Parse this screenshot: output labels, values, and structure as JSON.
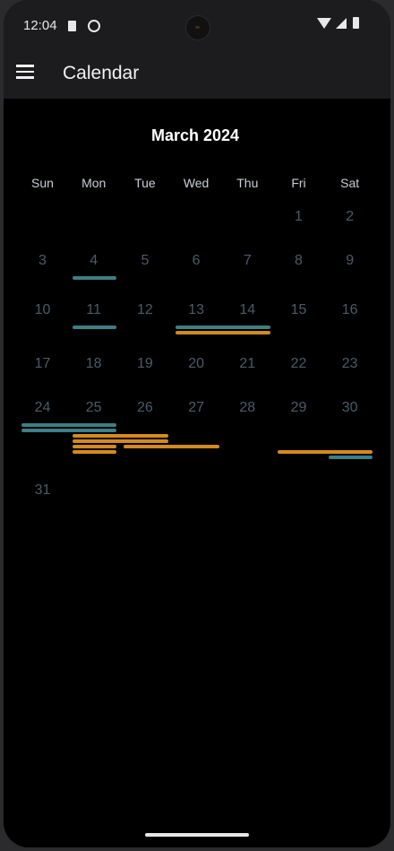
{
  "status_bar": {
    "time": "12:04",
    "icons": [
      "sd-card-icon",
      "face-icon",
      "wifi-icon",
      "cell-signal-icon",
      "battery-icon"
    ]
  },
  "app_bar": {
    "title": "Calendar",
    "menu_icon": "hamburger-menu-icon"
  },
  "calendar": {
    "month_label": "March 2024",
    "weekdays": [
      "Sun",
      "Mon",
      "Tue",
      "Wed",
      "Thu",
      "Fri",
      "Sat"
    ],
    "days": [
      {
        "label": "1",
        "week": 0,
        "dow": 5
      },
      {
        "label": "2",
        "week": 0,
        "dow": 6
      },
      {
        "label": "3",
        "week": 1,
        "dow": 0
      },
      {
        "label": "4",
        "week": 1,
        "dow": 1
      },
      {
        "label": "5",
        "week": 1,
        "dow": 2
      },
      {
        "label": "6",
        "week": 1,
        "dow": 3
      },
      {
        "label": "7",
        "week": 1,
        "dow": 4
      },
      {
        "label": "8",
        "week": 1,
        "dow": 5
      },
      {
        "label": "9",
        "week": 1,
        "dow": 6
      },
      {
        "label": "10",
        "week": 2,
        "dow": 0
      },
      {
        "label": "11",
        "week": 2,
        "dow": 1
      },
      {
        "label": "12",
        "week": 2,
        "dow": 2
      },
      {
        "label": "13",
        "week": 2,
        "dow": 3
      },
      {
        "label": "14",
        "week": 2,
        "dow": 4
      },
      {
        "label": "15",
        "week": 2,
        "dow": 5
      },
      {
        "label": "16",
        "week": 2,
        "dow": 6
      },
      {
        "label": "17",
        "week": 3,
        "dow": 0
      },
      {
        "label": "18",
        "week": 3,
        "dow": 1
      },
      {
        "label": "19",
        "week": 3,
        "dow": 2
      },
      {
        "label": "20",
        "week": 3,
        "dow": 3
      },
      {
        "label": "21",
        "week": 3,
        "dow": 4
      },
      {
        "label": "22",
        "week": 3,
        "dow": 5
      },
      {
        "label": "23",
        "week": 3,
        "dow": 6
      },
      {
        "label": "24",
        "week": 4,
        "dow": 0
      },
      {
        "label": "25",
        "week": 4,
        "dow": 1
      },
      {
        "label": "26",
        "week": 4,
        "dow": 2
      },
      {
        "label": "27",
        "week": 4,
        "dow": 3
      },
      {
        "label": "28",
        "week": 4,
        "dow": 4
      },
      {
        "label": "29",
        "week": 4,
        "dow": 5
      },
      {
        "label": "30",
        "week": 4,
        "dow": 6
      },
      {
        "label": "31",
        "week": 5,
        "dow": 0
      }
    ],
    "events": [
      {
        "color": "teal",
        "week": 1,
        "start": 1,
        "span": 1,
        "lane": 0
      },
      {
        "color": "teal",
        "week": 2,
        "start": 1,
        "span": 1,
        "lane": 0
      },
      {
        "color": "teal",
        "week": 2,
        "start": 3,
        "span": 2,
        "lane": 0
      },
      {
        "color": "orange",
        "week": 2,
        "start": 3,
        "span": 2,
        "lane": 1
      },
      {
        "color": "teal",
        "week": 4,
        "start": 0,
        "span": 2,
        "lane": 0
      },
      {
        "color": "teal",
        "week": 4,
        "start": 0,
        "span": 2,
        "lane": 1
      },
      {
        "color": "orange",
        "week": 4,
        "start": 1,
        "span": 2,
        "lane": 2
      },
      {
        "color": "orange",
        "week": 4,
        "start": 1,
        "span": 2,
        "lane": 3
      },
      {
        "color": "orange",
        "week": 4,
        "start": 1,
        "span": 1,
        "lane": 4
      },
      {
        "color": "orange",
        "week": 4,
        "start": 2,
        "span": 2,
        "lane": 4
      },
      {
        "color": "orange",
        "week": 4,
        "start": 1,
        "span": 1,
        "lane": 5
      },
      {
        "color": "orange",
        "week": 4,
        "start": 5,
        "span": 2,
        "lane": 5
      },
      {
        "color": "teal",
        "week": 4,
        "start": 6,
        "span": 1,
        "lane": 6
      }
    ],
    "colors": {
      "teal": "#3e7f83",
      "orange": "#d38a1e",
      "day_number": "#4a5b68"
    }
  }
}
